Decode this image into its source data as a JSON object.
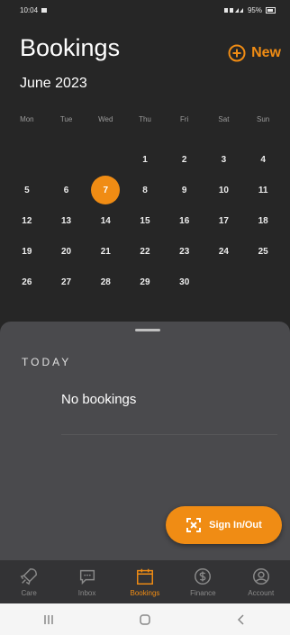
{
  "status_bar": {
    "time": "10:04",
    "battery": "95%"
  },
  "header": {
    "title": "Bookings",
    "new_label": "New"
  },
  "calendar": {
    "month": "June 2023",
    "weekdays": [
      "Mon",
      "Tue",
      "Wed",
      "Thu",
      "Fri",
      "Sat",
      "Sun"
    ],
    "first_weekday_index": 3,
    "days": [
      "1",
      "2",
      "3",
      "4",
      "5",
      "6",
      "7",
      "8",
      "9",
      "10",
      "11",
      "12",
      "13",
      "14",
      "15",
      "16",
      "17",
      "18",
      "19",
      "20",
      "21",
      "22",
      "23",
      "24",
      "25",
      "26",
      "27",
      "28",
      "29",
      "30"
    ],
    "selected_day": "7"
  },
  "sheet": {
    "section_label": "TODAY",
    "empty_text": "No bookings",
    "fab_label": "Sign In/Out"
  },
  "tabs": [
    {
      "label": "Care",
      "icon": "rocket-icon",
      "active": false
    },
    {
      "label": "Inbox",
      "icon": "chat-icon",
      "active": false
    },
    {
      "label": "Bookings",
      "icon": "calendar-icon",
      "active": true
    },
    {
      "label": "Finance",
      "icon": "dollar-icon",
      "active": false
    },
    {
      "label": "Account",
      "icon": "account-icon",
      "active": false
    }
  ],
  "colors": {
    "accent": "#f08c14",
    "background": "#262626",
    "sheet": "#4a4a4d"
  }
}
